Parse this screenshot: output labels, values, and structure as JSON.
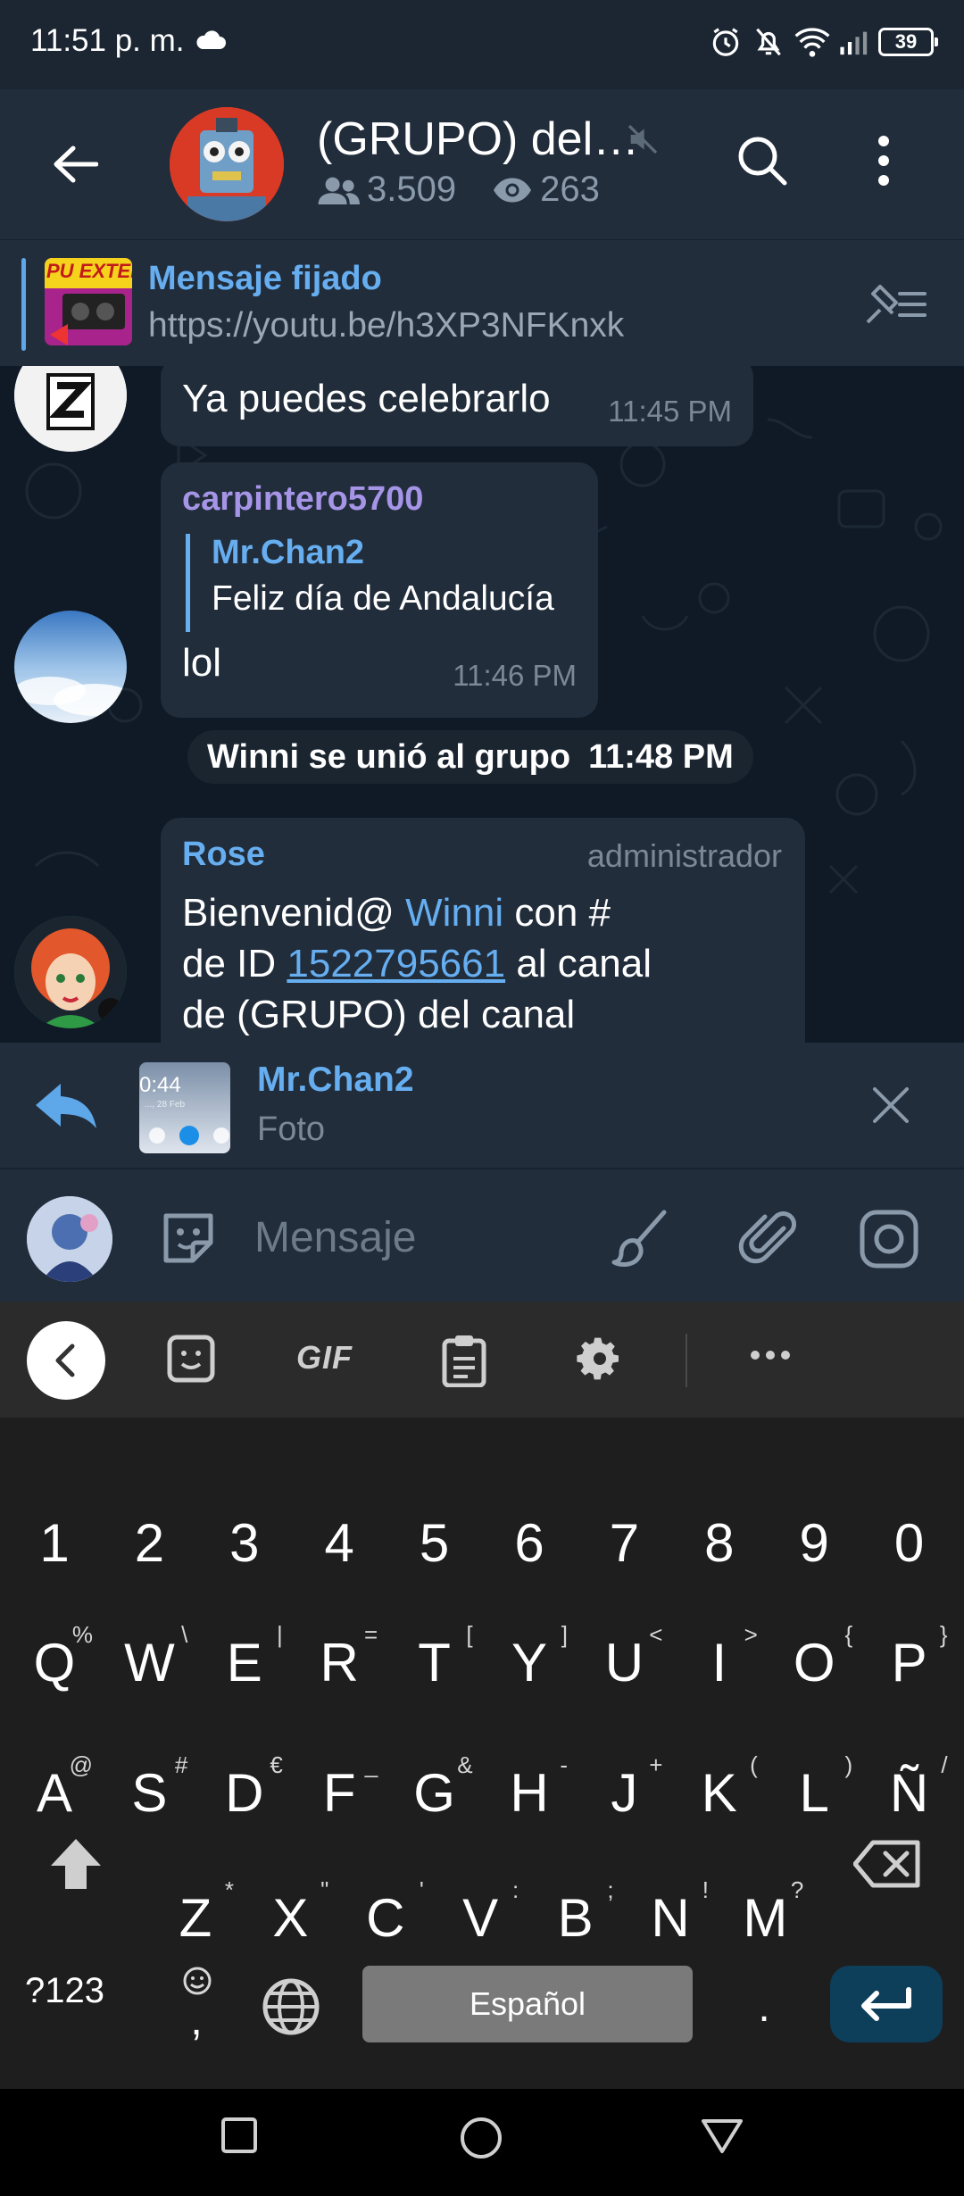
{
  "status_bar": {
    "time": "11:51 p. m.",
    "battery": "39"
  },
  "header": {
    "title": "(GRUPO) del…",
    "members": "3.509",
    "viewers": "263"
  },
  "pinned": {
    "title": "Mensaje fijado",
    "text": "https://youtu.be/h3XP3NFKnxk",
    "thumb_text": "PU EXTER"
  },
  "messages": [
    {
      "text": "Ya puedes celebrarlo",
      "time": "11:45 PM"
    },
    {
      "sender": "carpintero5700",
      "quote_name": "Mr.Chan2",
      "quote_text": "Feliz día de Andalucía",
      "text": "lol",
      "time": "11:46 PM"
    },
    {
      "sender": "Rose",
      "role": "administrador",
      "text_parts": [
        "Bienvenid@ ",
        "Winni",
        " con #",
        "de ID ",
        "1522795661",
        " al canal",
        "de (GRUPO) del canal"
      ]
    }
  ],
  "service_message": {
    "text": "Winni se unió al grupo",
    "time": "11:48 PM"
  },
  "reply": {
    "name": "Mr.Chan2",
    "text": "Foto",
    "thumb_time": "0:44",
    "thumb_date": "..., 28 Feb"
  },
  "input": {
    "placeholder": "Mensaje"
  },
  "keyboard": {
    "gif_label": "GIF",
    "number_row": [
      "1",
      "2",
      "3",
      "4",
      "5",
      "6",
      "7",
      "8",
      "9",
      "0"
    ],
    "row1": [
      {
        "k": "Q",
        "h": "%"
      },
      {
        "k": "W",
        "h": "\\"
      },
      {
        "k": "E",
        "h": "|"
      },
      {
        "k": "R",
        "h": "="
      },
      {
        "k": "T",
        "h": "["
      },
      {
        "k": "Y",
        "h": "]"
      },
      {
        "k": "U",
        "h": "<"
      },
      {
        "k": "I",
        "h": ">"
      },
      {
        "k": "O",
        "h": "{"
      },
      {
        "k": "P",
        "h": "}"
      }
    ],
    "row2": [
      {
        "k": "A",
        "h": "@"
      },
      {
        "k": "S",
        "h": "#"
      },
      {
        "k": "D",
        "h": "€"
      },
      {
        "k": "F",
        "h": "_"
      },
      {
        "k": "G",
        "h": "&"
      },
      {
        "k": "H",
        "h": "-"
      },
      {
        "k": "J",
        "h": "+"
      },
      {
        "k": "K",
        "h": "("
      },
      {
        "k": "L",
        "h": ")"
      },
      {
        "k": "Ñ",
        "h": "/"
      }
    ],
    "row3": [
      {
        "k": "Z",
        "h": "*"
      },
      {
        "k": "X",
        "h": "\""
      },
      {
        "k": "C",
        "h": "'"
      },
      {
        "k": "V",
        "h": ":"
      },
      {
        "k": "B",
        "h": ";"
      },
      {
        "k": "N",
        "h": "!"
      },
      {
        "k": "M",
        "h": "?"
      }
    ],
    "sym_label": "?123",
    "comma": ",",
    "space_label": "Español",
    "period": "."
  },
  "colors": {
    "accent": "#66aef0",
    "bubble": "#212d3b",
    "chat_bg": "#0f1a26",
    "sender_purple": "#a695e7",
    "enter_key": "#0d3f5b"
  }
}
